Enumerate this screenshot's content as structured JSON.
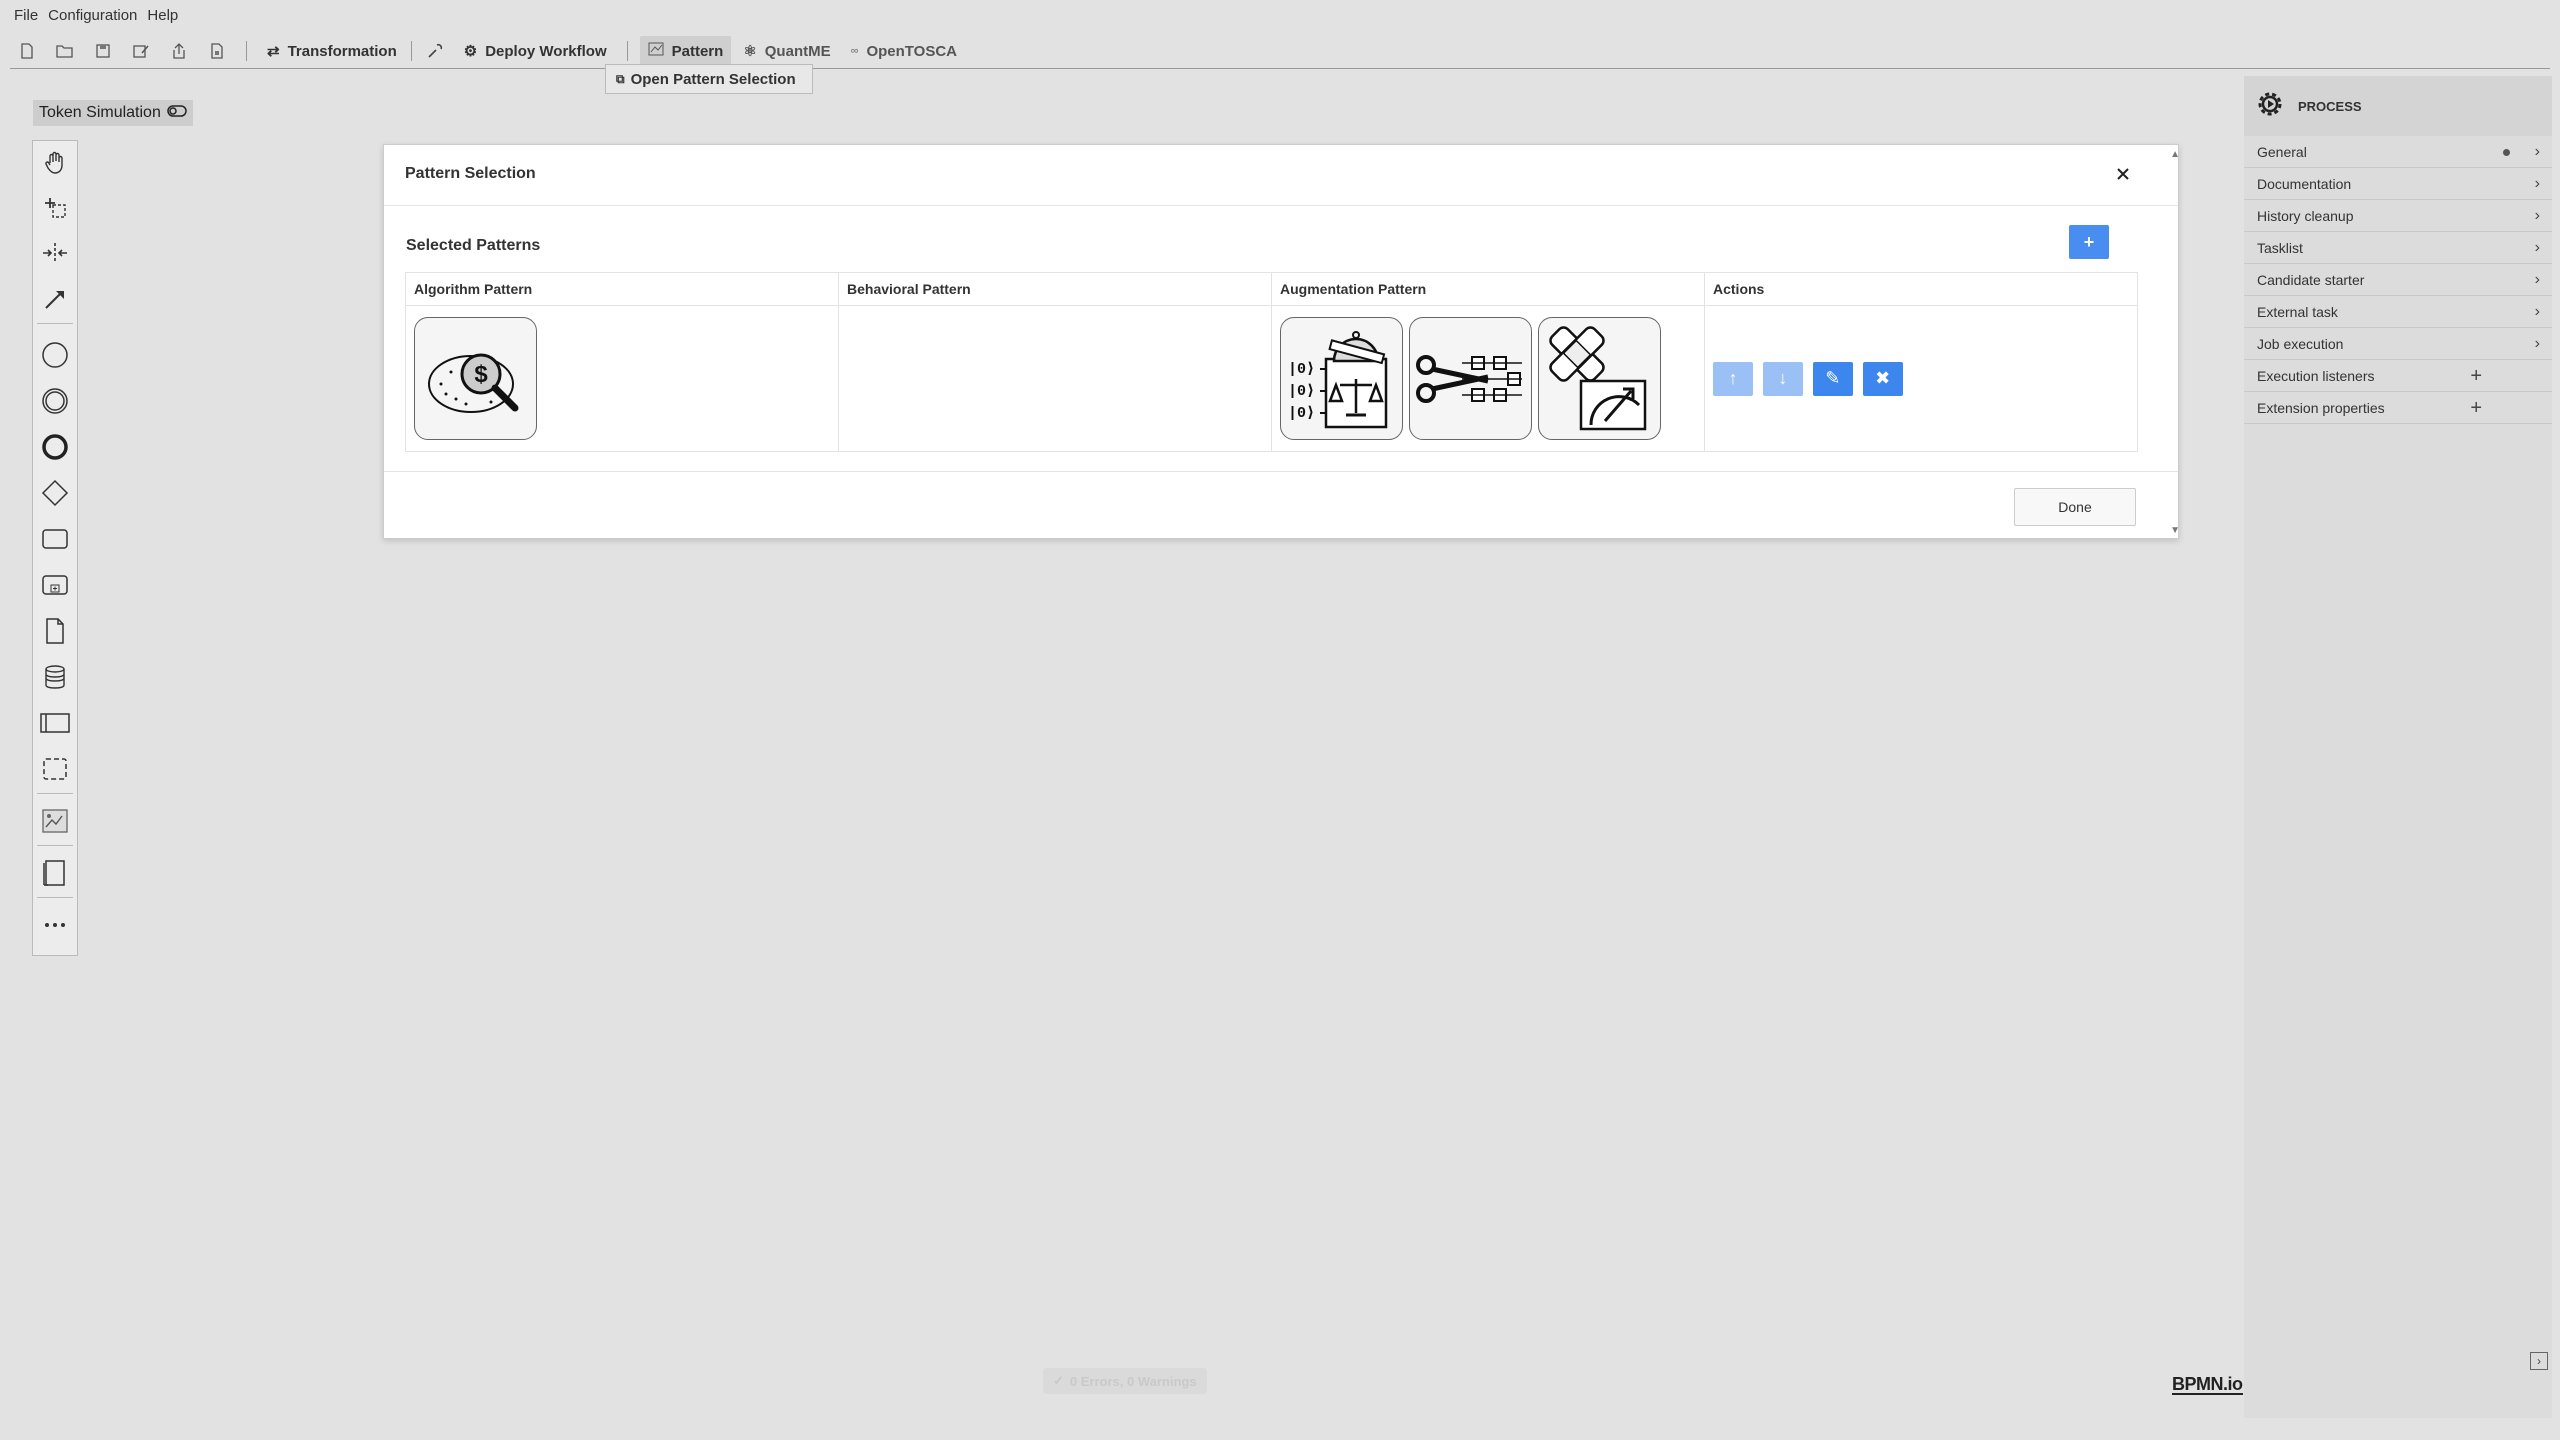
{
  "menu": {
    "file": "File",
    "configuration": "Configuration",
    "help": "Help"
  },
  "toolbar": {
    "transformation": "Transformation",
    "deploy_workflow": "Deploy Workflow",
    "pattern": "Pattern",
    "quantme": "QuantME",
    "opentosca": "OpenTOSCA"
  },
  "dropdown": {
    "open_pattern_selection": "Open Pattern Selection"
  },
  "token_simulation": {
    "label": "Token Simulation"
  },
  "modal": {
    "title": "Pattern Selection",
    "section_title": "Selected Patterns",
    "add_label": "+",
    "columns": [
      "Algorithm Pattern",
      "Behavioral Pattern",
      "Augmentation Pattern",
      "Actions"
    ],
    "algorithm_patterns": [
      "amplitude-amplification-icon"
    ],
    "behavioral_patterns": [],
    "augmentation_patterns": [
      "readout-error-mitigation-icon",
      "circuit-cutting-icon",
      "error-correction-icon"
    ],
    "actions": {
      "up_label": "↑",
      "down_label": "↓",
      "edit_label": "✎",
      "delete_label": "✖"
    },
    "done_label": "Done"
  },
  "properties": {
    "header": "PROCESS",
    "groups": [
      {
        "label": "General",
        "type": "chevron",
        "dot": true
      },
      {
        "label": "Documentation",
        "type": "chevron"
      },
      {
        "label": "History cleanup",
        "type": "chevron"
      },
      {
        "label": "Tasklist",
        "type": "chevron"
      },
      {
        "label": "Candidate starter",
        "type": "chevron"
      },
      {
        "label": "External task",
        "type": "chevron"
      },
      {
        "label": "Job execution",
        "type": "chevron"
      },
      {
        "label": "Execution listeners",
        "type": "plus"
      },
      {
        "label": "Extension properties",
        "type": "plus"
      }
    ]
  },
  "status": {
    "text": "0 Errors, 0 Warnings"
  },
  "branding": {
    "text": "BPMN.io"
  },
  "colors": {
    "primary": "#3d86ee",
    "primary_light": "#9ac0f5",
    "canvas": "#e2e2e2"
  }
}
